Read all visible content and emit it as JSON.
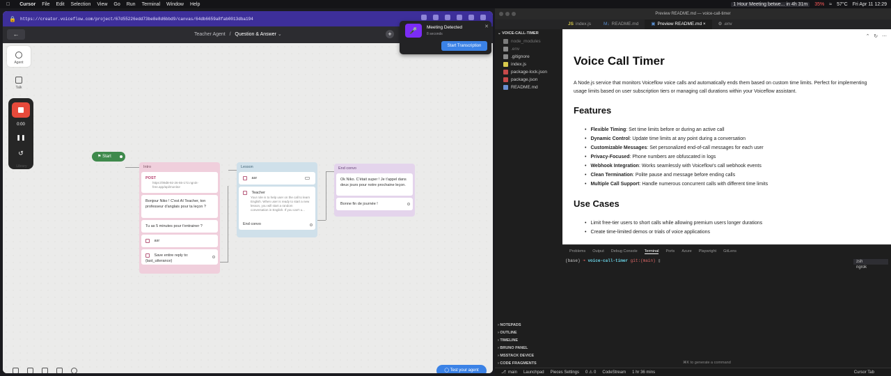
{
  "menubar": {
    "app": "Cursor",
    "items": [
      "File",
      "Edit",
      "Selection",
      "View",
      "Go",
      "Run",
      "Terminal",
      "Window",
      "Help"
    ],
    "meeting": "1 Hour Meeting betwe... in 4h 31m",
    "battery": "35%",
    "temp": "57°C",
    "datetime": "Fri Apr 11  12:29"
  },
  "browser": {
    "url": "https://creator.voiceflow.com/project/67d55226edd73be8e8d6bbd9/canvas/64db6659a8fab0013dba194",
    "breadcrumb_project": "Teacher Agent",
    "breadcrumb_flow": "Question & Answer",
    "rail_agent": "Agent",
    "rail_talk": "Talk",
    "rail_library": "Library",
    "recorder_time": "0:00",
    "test_button": "Test your agent",
    "start_node": "Start"
  },
  "blocks": {
    "intro": {
      "title": "Intro",
      "post_label": "POST",
      "post_url": "https://09d8-92-26-55-172.ngrok-free.app/api/monitor",
      "msg1": "Bonjour Niko ! C'est AI Teacher, ton professeur d'anglais pour ta leçon ?",
      "msg2": "Tu as 5 minutes pour t'entrainer ?",
      "asr": "asr",
      "save": "Save entire reply to: {last_utterance}"
    },
    "lesson": {
      "title": "Lesson",
      "asr": "asr",
      "teacher": "Teacher",
      "teacher_desc": "Your role is to help user on the call to learn English. When user is ready to start a new lesson, you will start a random conversation in English. If you can't u...",
      "end": "End convo"
    },
    "endconvo": {
      "title": "End convo",
      "msg1": "Ok Niko. C'était super ! Je t'appel dans deux jours pour notre prochaine leçon.",
      "msg2": "Bonne fin de journée !"
    }
  },
  "meeting_popup": {
    "title": "Meeting Detected",
    "subtitle": "8 seconds",
    "button": "Start Transcription"
  },
  "editor": {
    "window_title": "Preview README.md — voice-call-timer",
    "tabs": [
      "index.js",
      "README.md",
      "Preview README.md",
      ".env"
    ],
    "explorer_title": "VOICE-CALL-TIMER",
    "files": [
      {
        "name": "node_modules",
        "dim": true,
        "color": "#7a7a7a"
      },
      {
        "name": ".env",
        "dim": true,
        "color": "#8a8a8a"
      },
      {
        "name": ".gitignore",
        "dim": false,
        "color": "#8a8a8a"
      },
      {
        "name": "index.js",
        "dim": false,
        "color": "#d7c94c"
      },
      {
        "name": "package-lock.json",
        "dim": false,
        "color": "#c64a4a"
      },
      {
        "name": "package.json",
        "dim": false,
        "color": "#c64a4a"
      },
      {
        "name": "README.md",
        "dim": false,
        "color": "#6a8fd0"
      }
    ],
    "doc": {
      "h1": "Voice Call Timer",
      "intro": "A Node.js service that monitors Voiceflow voice calls and automatically ends them based on custom time limits. Perfect for implementing usage limits based on user subscription tiers or managing call durations within your Voiceflow assistant.",
      "features_h": "Features",
      "features": [
        {
          "b": "Flexible Timing",
          "t": ": Set time limits before or during an active call"
        },
        {
          "b": "Dynamic Control",
          "t": ": Update time limits at any point during a conversation"
        },
        {
          "b": "Customizable Messages",
          "t": ": Set personalized end-of-call messages for each user"
        },
        {
          "b": "Privacy-Focused",
          "t": ": Phone numbers are obfuscated in logs"
        },
        {
          "b": "Webhook Integration",
          "t": ": Works seamlessly with Voiceflow's call webhook events"
        },
        {
          "b": "Clean Termination",
          "t": ": Polite pause and message before ending calls"
        },
        {
          "b": "Multiple Call Support",
          "t": ": Handle numerous concurrent calls with different time limits"
        }
      ],
      "usecases_h": "Use Cases",
      "usecases": [
        "Limit free-tier users to short calls while allowing premium users longer durations",
        "Create time-limited demos or trials of voice applications"
      ]
    },
    "panel_tabs": [
      "Problems",
      "Output",
      "Debug Console",
      "Terminal",
      "Ports",
      "Azure",
      "Playwright",
      "GitLens"
    ],
    "prompt": {
      "env": "(base)",
      "dir": "voice-call-timer",
      "git": "git:(main)"
    },
    "terminals": [
      "zsh",
      "ngrok"
    ],
    "sections": [
      "NOTEPADS",
      "OUTLINE",
      "TIMELINE",
      "BRUNO PANEL",
      "MSSTACK DEVICE",
      "CODE FRAGMENTS"
    ],
    "kbd_hint": "⌘K to generate a command",
    "status": {
      "branch": "main",
      "launchpad": "Launchpad",
      "pieces": "Pieces Settings",
      "errors": "0 ⚠ 0",
      "codestream": "CodeStream",
      "time": "1 hr 36 mins",
      "cursor_tab": "Cursor Tab"
    }
  }
}
